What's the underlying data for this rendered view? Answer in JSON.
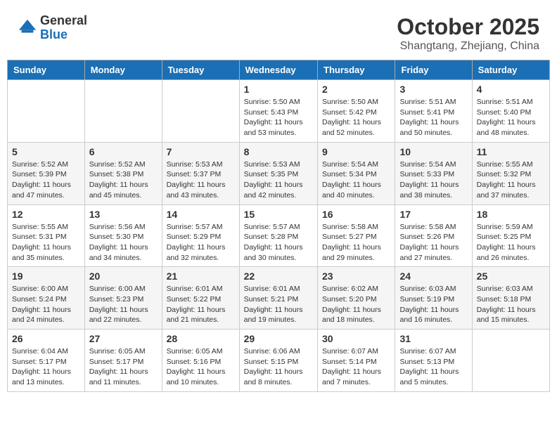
{
  "header": {
    "logo_general": "General",
    "logo_blue": "Blue",
    "month_title": "October 2025",
    "location": "Shangtang, Zhejiang, China"
  },
  "days_of_week": [
    "Sunday",
    "Monday",
    "Tuesday",
    "Wednesday",
    "Thursday",
    "Friday",
    "Saturday"
  ],
  "weeks": [
    [
      {
        "day": "",
        "info": ""
      },
      {
        "day": "",
        "info": ""
      },
      {
        "day": "",
        "info": ""
      },
      {
        "day": "1",
        "info": "Sunrise: 5:50 AM\nSunset: 5:43 PM\nDaylight: 11 hours\nand 53 minutes."
      },
      {
        "day": "2",
        "info": "Sunrise: 5:50 AM\nSunset: 5:42 PM\nDaylight: 11 hours\nand 52 minutes."
      },
      {
        "day": "3",
        "info": "Sunrise: 5:51 AM\nSunset: 5:41 PM\nDaylight: 11 hours\nand 50 minutes."
      },
      {
        "day": "4",
        "info": "Sunrise: 5:51 AM\nSunset: 5:40 PM\nDaylight: 11 hours\nand 48 minutes."
      }
    ],
    [
      {
        "day": "5",
        "info": "Sunrise: 5:52 AM\nSunset: 5:39 PM\nDaylight: 11 hours\nand 47 minutes."
      },
      {
        "day": "6",
        "info": "Sunrise: 5:52 AM\nSunset: 5:38 PM\nDaylight: 11 hours\nand 45 minutes."
      },
      {
        "day": "7",
        "info": "Sunrise: 5:53 AM\nSunset: 5:37 PM\nDaylight: 11 hours\nand 43 minutes."
      },
      {
        "day": "8",
        "info": "Sunrise: 5:53 AM\nSunset: 5:35 PM\nDaylight: 11 hours\nand 42 minutes."
      },
      {
        "day": "9",
        "info": "Sunrise: 5:54 AM\nSunset: 5:34 PM\nDaylight: 11 hours\nand 40 minutes."
      },
      {
        "day": "10",
        "info": "Sunrise: 5:54 AM\nSunset: 5:33 PM\nDaylight: 11 hours\nand 38 minutes."
      },
      {
        "day": "11",
        "info": "Sunrise: 5:55 AM\nSunset: 5:32 PM\nDaylight: 11 hours\nand 37 minutes."
      }
    ],
    [
      {
        "day": "12",
        "info": "Sunrise: 5:55 AM\nSunset: 5:31 PM\nDaylight: 11 hours\nand 35 minutes."
      },
      {
        "day": "13",
        "info": "Sunrise: 5:56 AM\nSunset: 5:30 PM\nDaylight: 11 hours\nand 34 minutes."
      },
      {
        "day": "14",
        "info": "Sunrise: 5:57 AM\nSunset: 5:29 PM\nDaylight: 11 hours\nand 32 minutes."
      },
      {
        "day": "15",
        "info": "Sunrise: 5:57 AM\nSunset: 5:28 PM\nDaylight: 11 hours\nand 30 minutes."
      },
      {
        "day": "16",
        "info": "Sunrise: 5:58 AM\nSunset: 5:27 PM\nDaylight: 11 hours\nand 29 minutes."
      },
      {
        "day": "17",
        "info": "Sunrise: 5:58 AM\nSunset: 5:26 PM\nDaylight: 11 hours\nand 27 minutes."
      },
      {
        "day": "18",
        "info": "Sunrise: 5:59 AM\nSunset: 5:25 PM\nDaylight: 11 hours\nand 26 minutes."
      }
    ],
    [
      {
        "day": "19",
        "info": "Sunrise: 6:00 AM\nSunset: 5:24 PM\nDaylight: 11 hours\nand 24 minutes."
      },
      {
        "day": "20",
        "info": "Sunrise: 6:00 AM\nSunset: 5:23 PM\nDaylight: 11 hours\nand 22 minutes."
      },
      {
        "day": "21",
        "info": "Sunrise: 6:01 AM\nSunset: 5:22 PM\nDaylight: 11 hours\nand 21 minutes."
      },
      {
        "day": "22",
        "info": "Sunrise: 6:01 AM\nSunset: 5:21 PM\nDaylight: 11 hours\nand 19 minutes."
      },
      {
        "day": "23",
        "info": "Sunrise: 6:02 AM\nSunset: 5:20 PM\nDaylight: 11 hours\nand 18 minutes."
      },
      {
        "day": "24",
        "info": "Sunrise: 6:03 AM\nSunset: 5:19 PM\nDaylight: 11 hours\nand 16 minutes."
      },
      {
        "day": "25",
        "info": "Sunrise: 6:03 AM\nSunset: 5:18 PM\nDaylight: 11 hours\nand 15 minutes."
      }
    ],
    [
      {
        "day": "26",
        "info": "Sunrise: 6:04 AM\nSunset: 5:17 PM\nDaylight: 11 hours\nand 13 minutes."
      },
      {
        "day": "27",
        "info": "Sunrise: 6:05 AM\nSunset: 5:17 PM\nDaylight: 11 hours\nand 11 minutes."
      },
      {
        "day": "28",
        "info": "Sunrise: 6:05 AM\nSunset: 5:16 PM\nDaylight: 11 hours\nand 10 minutes."
      },
      {
        "day": "29",
        "info": "Sunrise: 6:06 AM\nSunset: 5:15 PM\nDaylight: 11 hours\nand 8 minutes."
      },
      {
        "day": "30",
        "info": "Sunrise: 6:07 AM\nSunset: 5:14 PM\nDaylight: 11 hours\nand 7 minutes."
      },
      {
        "day": "31",
        "info": "Sunrise: 6:07 AM\nSunset: 5:13 PM\nDaylight: 11 hours\nand 5 minutes."
      },
      {
        "day": "",
        "info": ""
      }
    ]
  ]
}
